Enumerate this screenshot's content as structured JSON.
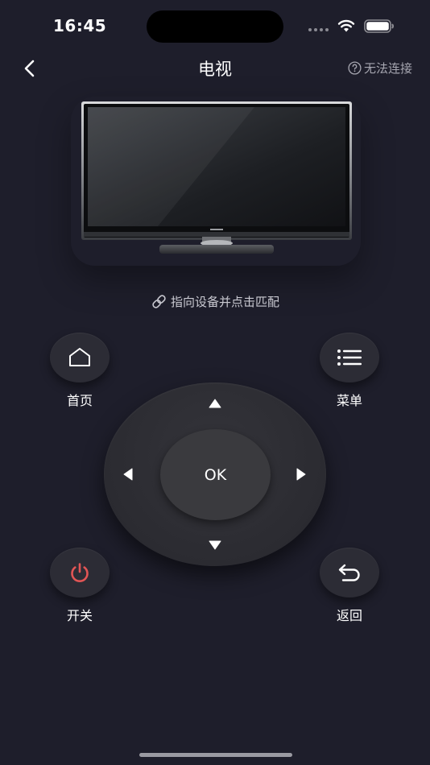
{
  "status_bar": {
    "time": "16:45"
  },
  "nav": {
    "back_icon": "chevron-left-icon",
    "title": "电视",
    "cannot_connect": "无法连接",
    "cannot_connect_icon": "question-circle-icon"
  },
  "device": {
    "image": "television"
  },
  "hint": {
    "icon": "link-icon",
    "text": "指向设备并点击匹配"
  },
  "buttons": {
    "home": {
      "label": "首页",
      "icon": "home-icon"
    },
    "menu": {
      "label": "菜单",
      "icon": "menu-icon"
    },
    "power": {
      "label": "开关",
      "icon": "power-icon"
    },
    "back": {
      "label": "返回",
      "icon": "return-icon"
    }
  },
  "dpad": {
    "ok_label": "OK",
    "icons": [
      "arrow-up-icon",
      "arrow-down-icon",
      "arrow-left-icon",
      "arrow-right-icon"
    ]
  },
  "colors": {
    "background": "#1e1e2b",
    "button": "#2c2c35",
    "power_red": "#e25555",
    "muted_text": "#a6a6b0"
  }
}
